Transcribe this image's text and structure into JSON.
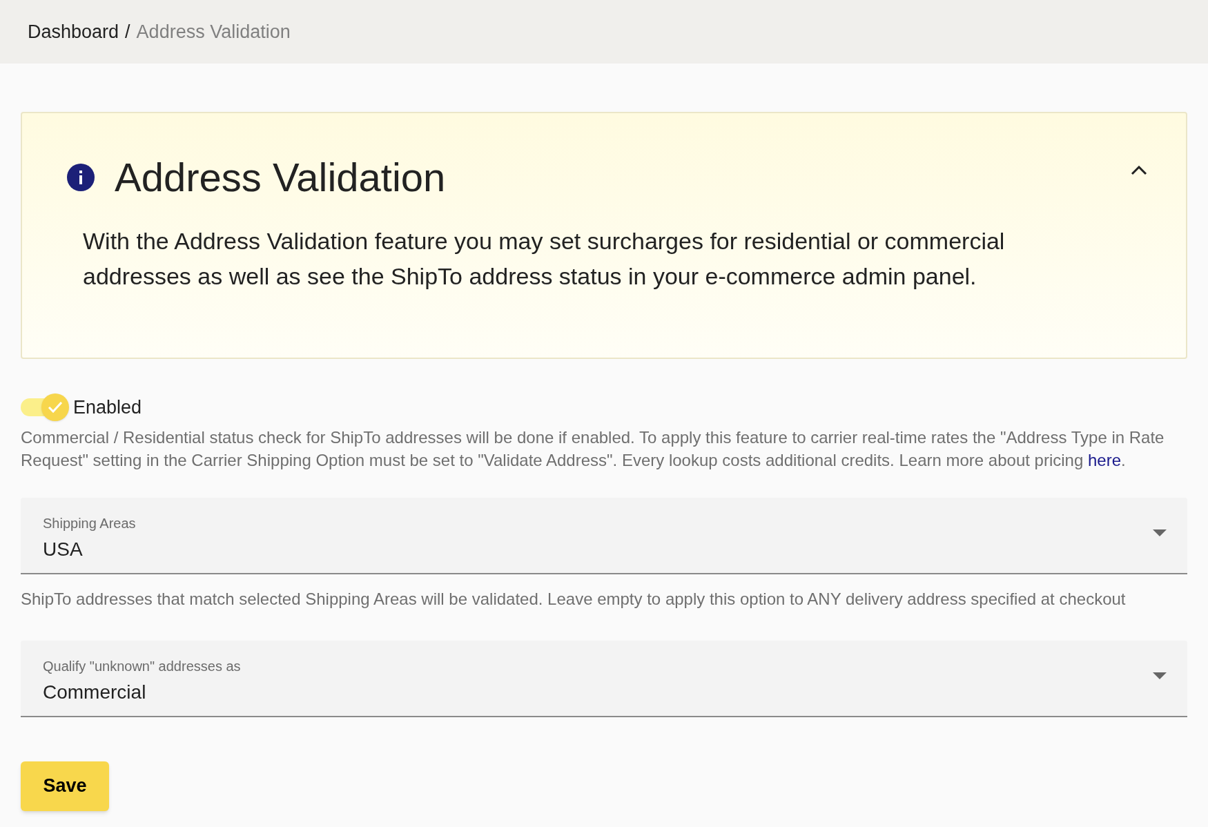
{
  "breadcrumb_separator": "/",
  "breadcrumb": [
    {
      "label": "Dashboard",
      "current": false
    },
    {
      "label": "Address Validation",
      "current": true
    }
  ],
  "info_panel": {
    "title": "Address Validation",
    "expanded": true,
    "text": "With the Address Validation feature you may set surcharges for residential or commercial addresses as well as see the ShipTo address status in your e-commerce admin panel."
  },
  "toggle": {
    "label": "Enabled",
    "on": true
  },
  "description": {
    "text": "Commercial / Residential status check for ShipTo addresses will be done if enabled. To apply this feature to carrier real-time rates the \"Address Type in Rate Request\" setting in the Carrier Shipping Option must be set to \"Validate Address\". Every lookup costs additional credits. Learn more about pricing ",
    "link": "here",
    "after": "."
  },
  "fields": [
    {
      "label": "Shipping Areas",
      "value": "USA",
      "help": "ShipTo addresses that match selected Shipping Areas will be validated. Leave empty to apply this option to ANY delivery address specified at checkout"
    },
    {
      "label": "Qualify \"unknown\" addresses as",
      "value": "Commercial"
    }
  ],
  "buttons": [
    {
      "label": "Save"
    }
  ]
}
